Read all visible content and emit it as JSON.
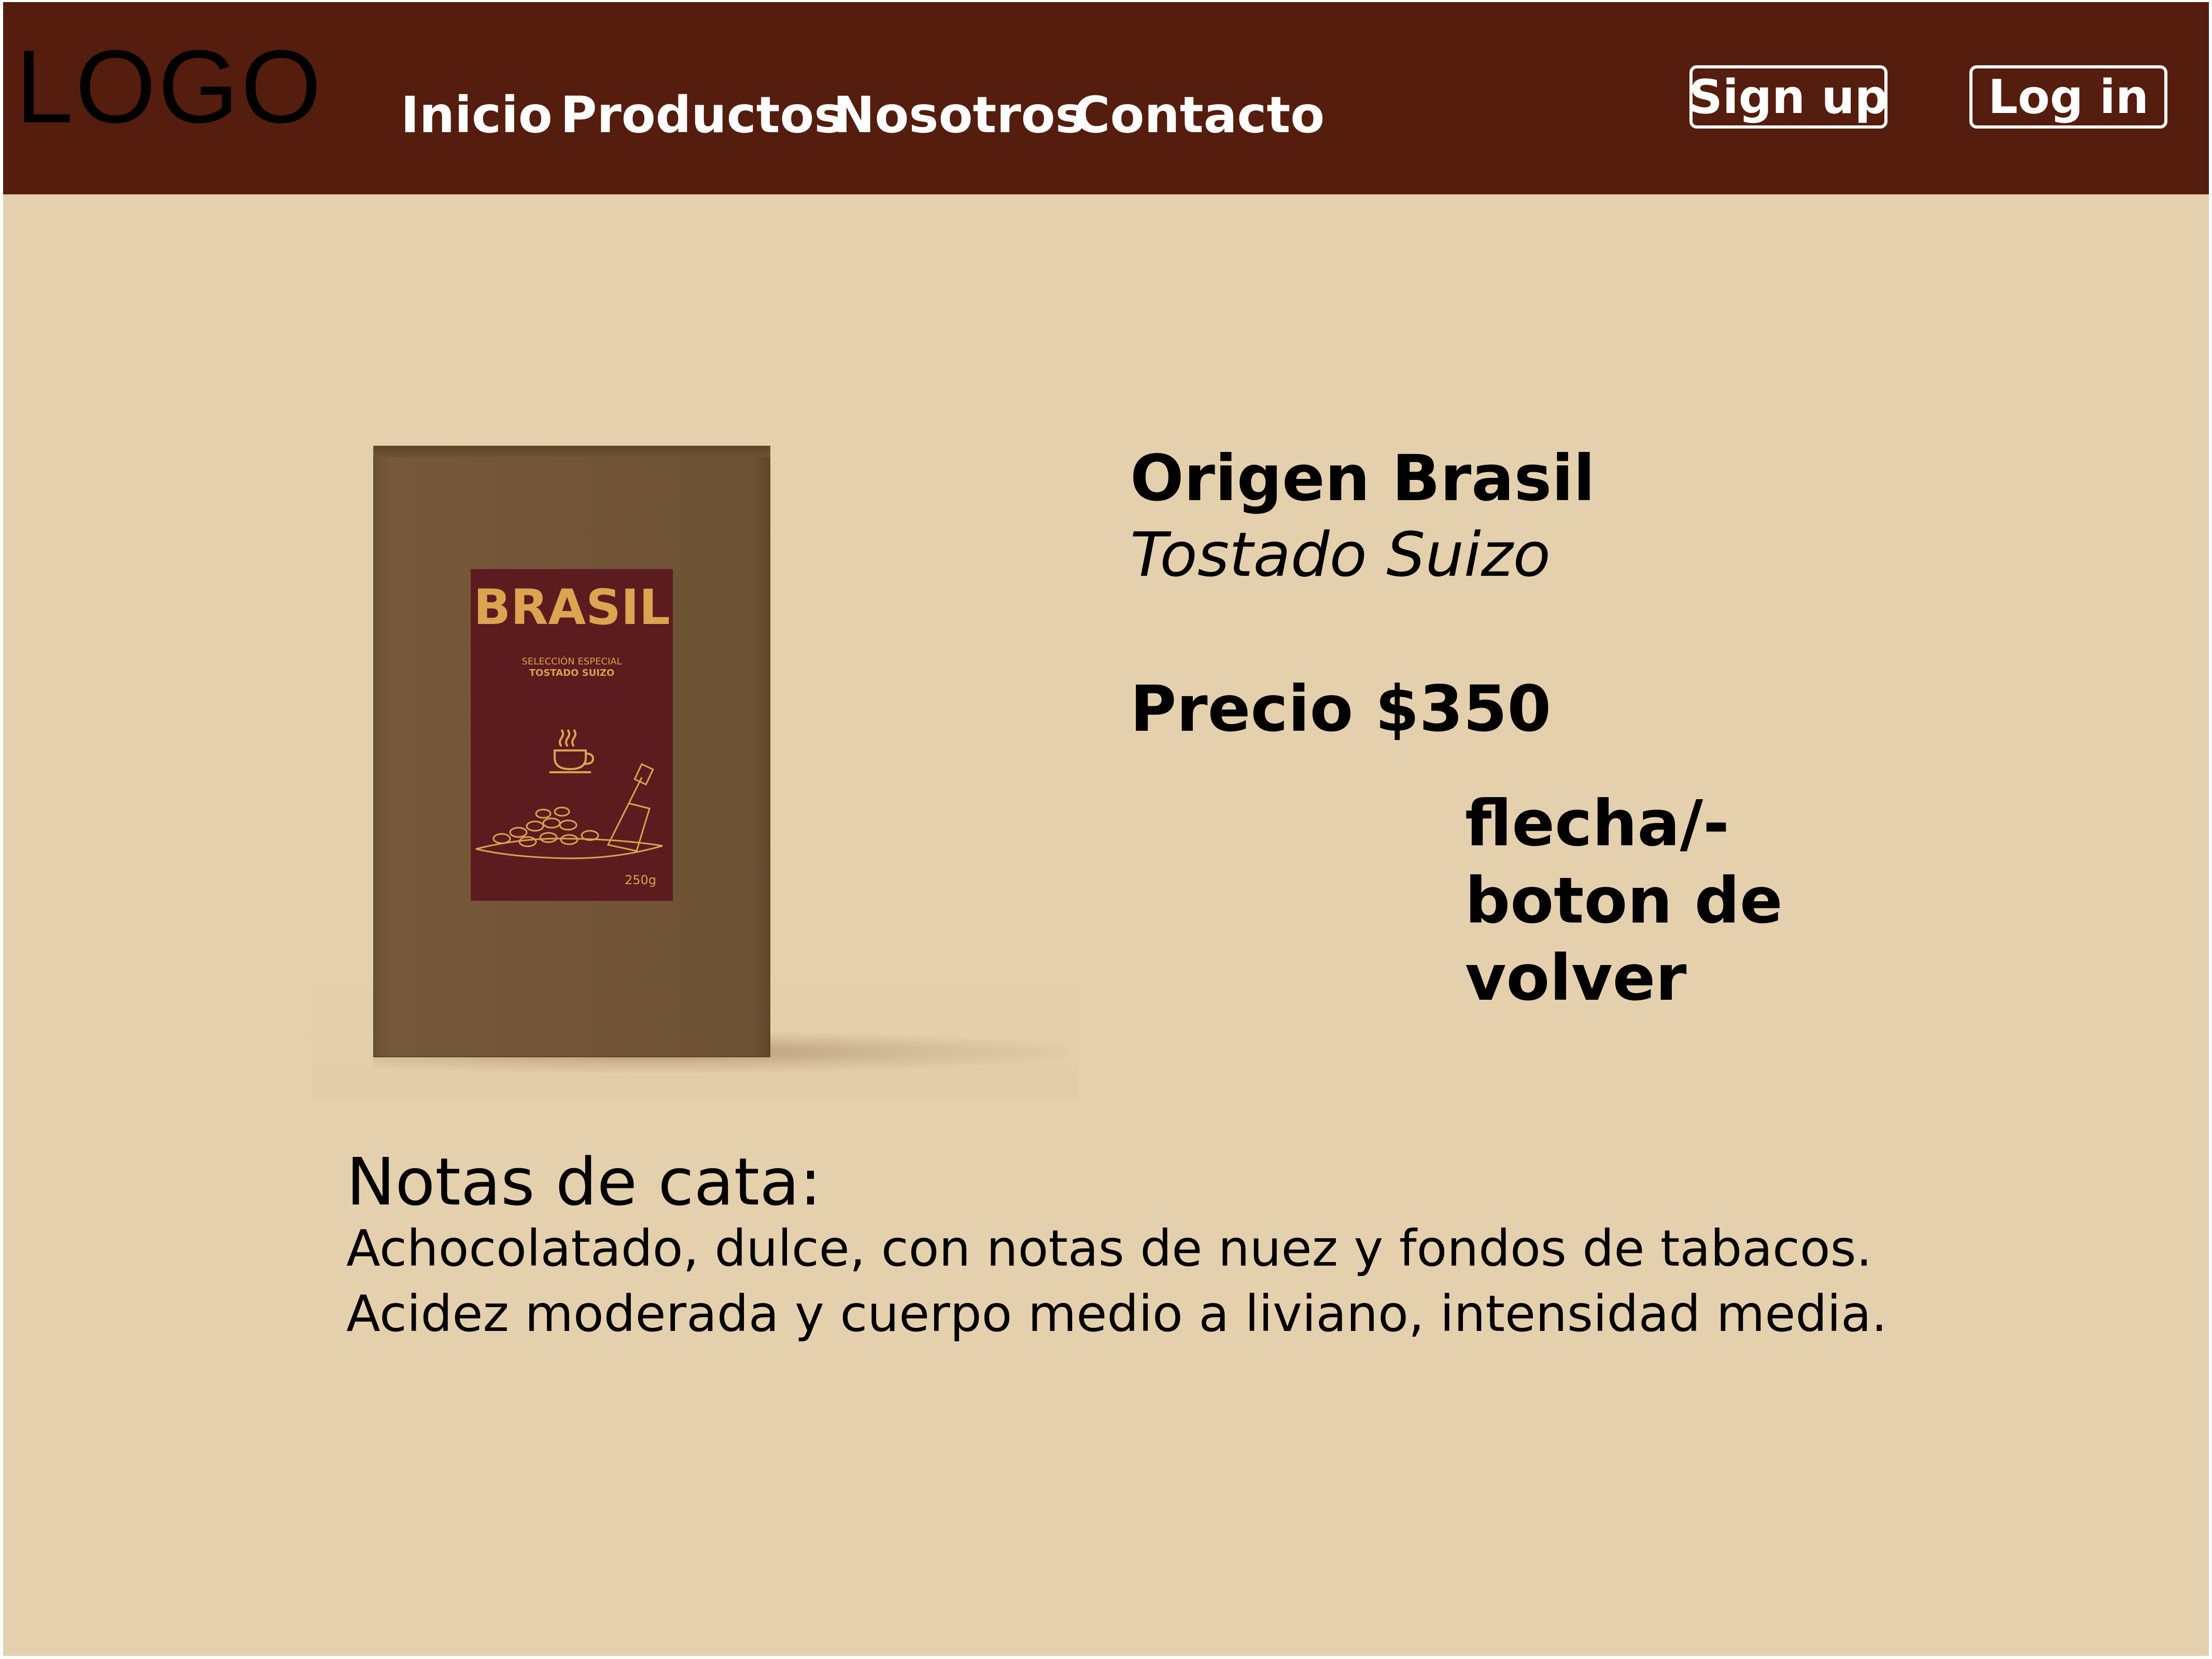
{
  "header": {
    "logo": "LOGO",
    "nav": [
      "Inicio",
      "Productos",
      "Nosotros",
      "Contacto"
    ],
    "signup_label": "Sign up",
    "login_label": "Log in"
  },
  "product": {
    "image": {
      "label_title": "BRASIL",
      "label_line1": "SELECCIÓN ESPECIAL",
      "label_line2": "TOSTADO SUIZO",
      "weight": "250g"
    },
    "title": "Origen Brasil",
    "subtitle": "Tostado Suizo",
    "price": "Precio $350",
    "back_note": [
      "flecha/-",
      "boton de",
      "volver"
    ]
  },
  "notes": {
    "heading": "Notas de cata:",
    "lines": [
      "Achocolatado, dulce, con notas de nuez y fondos de tabacos.",
      "Acidez moderada y cuerpo medio a liviano, intensidad media."
    ]
  },
  "colors": {
    "header_bg": "#551d0e",
    "page_bg": "#e5d0ae",
    "box": "#715536",
    "label_bg": "#5c1b1f",
    "label_gold": "#dba450"
  },
  "icons": [
    "coffee-cup-icon",
    "coffee-beans-scoop-icon"
  ]
}
